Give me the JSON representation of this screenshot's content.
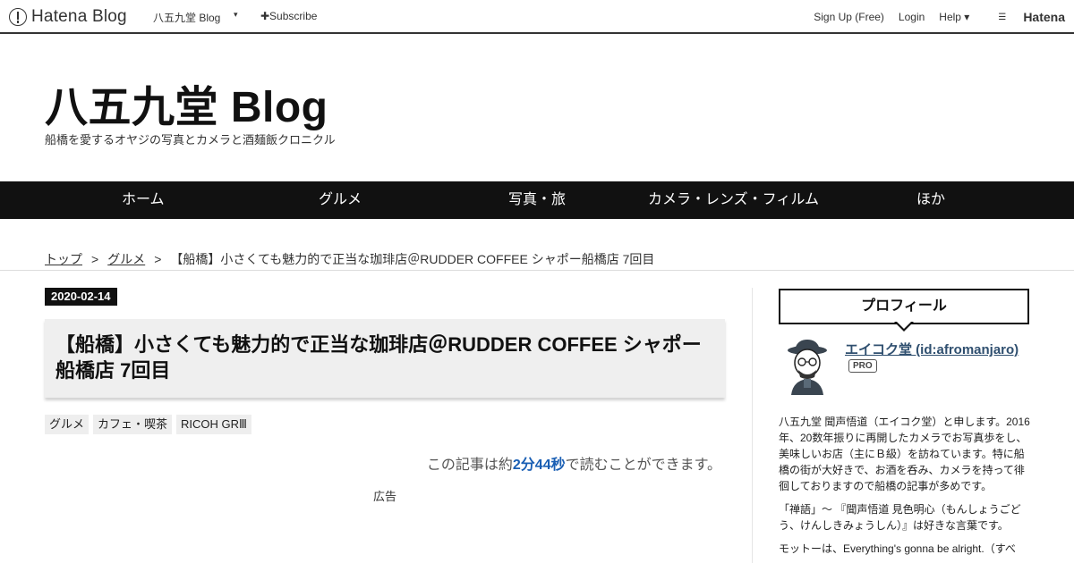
{
  "topbar": {
    "brand": "Hatena Blog",
    "blog_name": "八五九堂 Blog",
    "caret": "▾",
    "subscribe": "✚Subscribe",
    "signup": "Sign Up (Free)",
    "login": "Login",
    "help": "Help ▾",
    "hatena": "Hatena"
  },
  "header": {
    "title": "八五九堂 Blog",
    "description": "船橋を愛するオヤジの写真とカメラと酒麺飯クロニクル"
  },
  "nav": {
    "items": [
      "ホーム",
      "グルメ",
      "写真・旅",
      "カメラ・レンズ・フィルム",
      "ほか"
    ]
  },
  "breadcrumb": {
    "top": "トップ",
    "sep": ">",
    "category": "グルメ",
    "current": "【船橋】小さくても魅力的で正当な珈琲店＠RUDDER COFFEE シャポー船橋店 7回目"
  },
  "article": {
    "date": "2020-02-14",
    "title": "【船橋】小さくても魅力的で正当な珈琲店＠RUDDER COFFEE シャポー船橋店 7回目",
    "categories": [
      "グルメ",
      "カフェ・喫茶",
      "RICOH GRⅢ"
    ],
    "read_prefix": "この記事は約",
    "read_time": "2分44秒",
    "read_suffix": "で読むことができます。",
    "ad_label": "広告"
  },
  "sidebar": {
    "profile_heading": "プロフィール",
    "name": "エイコク堂 (id:afromanjaro)",
    "badge": "PRO",
    "bio": [
      "八五九堂 聞声悟道（エイコク堂）と申します。2016年、20数年振りに再開したカメラでお写真歩をし、美味しいお店（主にＢ級）を訪ねています。特に船橋の街が大好きで、お酒を呑み、カメラを持って徘徊しておりますので船橋の記事が多めです。",
      "「禅語」～ 『聞声悟道 見色明心（もんしょうごどう、けんしきみょうしん）』は好きな言葉です。",
      "モットーは、Everything's gonna be alright.（すべ"
    ]
  },
  "colors": {
    "nav_bg": "#111111",
    "accent_link": "#1a5fb4",
    "profile_name": "#2f4f6f"
  }
}
